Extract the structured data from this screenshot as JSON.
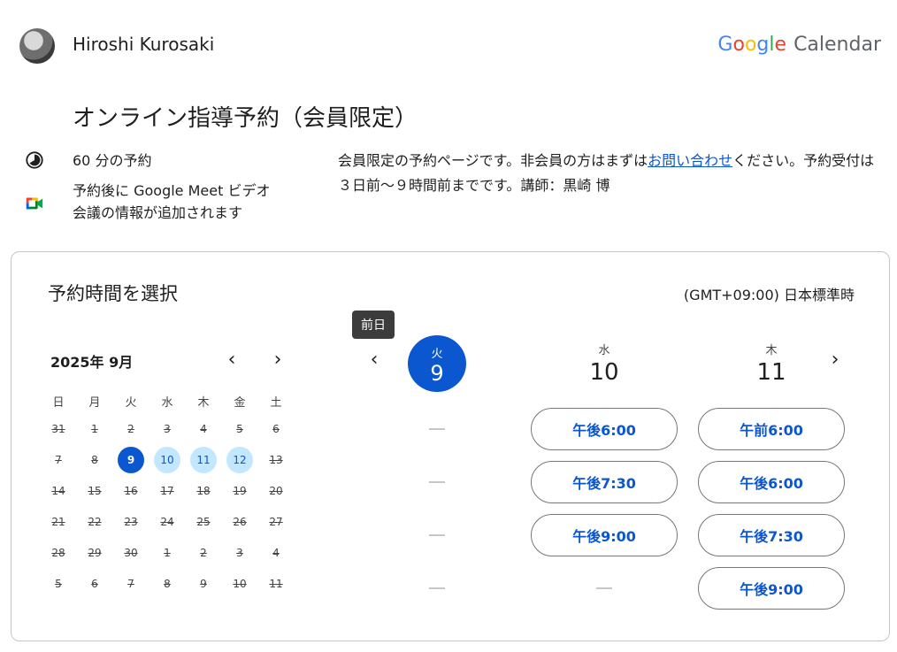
{
  "header": {
    "user_name": "Hiroshi Kurosaki",
    "brand_google": "Google",
    "brand_product": "Calendar"
  },
  "title": "オンライン指導予約（会員限定）",
  "info": {
    "duration": "60 分の予約",
    "meet_line1": "予約後に Google Meet ビデオ",
    "meet_line2": "会議の情報が追加されます"
  },
  "description": {
    "before_link": "会員限定の予約ページです。非会員の方はまずは",
    "link": "お問い合わせ",
    "after_link": "ください。予約受付は３日前〜９時間前までです。講師：黒崎 博"
  },
  "card": {
    "title": "予約時間を選択",
    "timezone": "(GMT+09:00) 日本標準時"
  },
  "mini_calendar": {
    "month_label": "2025年 9月",
    "weekdays": [
      "日",
      "月",
      "火",
      "水",
      "木",
      "金",
      "土"
    ],
    "weeks": [
      [
        {
          "d": "31",
          "s": "past"
        },
        {
          "d": "1",
          "s": "past"
        },
        {
          "d": "2",
          "s": "past"
        },
        {
          "d": "3",
          "s": "past"
        },
        {
          "d": "4",
          "s": "past"
        },
        {
          "d": "5",
          "s": "past"
        },
        {
          "d": "6",
          "s": "past"
        }
      ],
      [
        {
          "d": "7",
          "s": "past"
        },
        {
          "d": "8",
          "s": "past"
        },
        {
          "d": "9",
          "s": "sel"
        },
        {
          "d": "10",
          "s": "avail"
        },
        {
          "d": "11",
          "s": "avail"
        },
        {
          "d": "12",
          "s": "avail"
        },
        {
          "d": "13",
          "s": "past"
        }
      ],
      [
        {
          "d": "14",
          "s": "past"
        },
        {
          "d": "15",
          "s": "past"
        },
        {
          "d": "16",
          "s": "past"
        },
        {
          "d": "17",
          "s": "past"
        },
        {
          "d": "18",
          "s": "past"
        },
        {
          "d": "19",
          "s": "past"
        },
        {
          "d": "20",
          "s": "past"
        }
      ],
      [
        {
          "d": "21",
          "s": "past"
        },
        {
          "d": "22",
          "s": "past"
        },
        {
          "d": "23",
          "s": "past"
        },
        {
          "d": "24",
          "s": "past"
        },
        {
          "d": "25",
          "s": "past"
        },
        {
          "d": "26",
          "s": "past"
        },
        {
          "d": "27",
          "s": "past"
        }
      ],
      [
        {
          "d": "28",
          "s": "past"
        },
        {
          "d": "29",
          "s": "past"
        },
        {
          "d": "30",
          "s": "past"
        },
        {
          "d": "1",
          "s": "past"
        },
        {
          "d": "2",
          "s": "past"
        },
        {
          "d": "3",
          "s": "past"
        },
        {
          "d": "4",
          "s": "past"
        }
      ],
      [
        {
          "d": "5",
          "s": "past"
        },
        {
          "d": "6",
          "s": "past"
        },
        {
          "d": "7",
          "s": "past"
        },
        {
          "d": "8",
          "s": "past"
        },
        {
          "d": "9",
          "s": "past"
        },
        {
          "d": "10",
          "s": "past"
        },
        {
          "d": "11",
          "s": "past"
        }
      ]
    ]
  },
  "tooltip": "前日",
  "day_columns": [
    {
      "weekday": "火",
      "day": "9",
      "slots": []
    },
    {
      "weekday": "水",
      "day": "10",
      "slots": [
        "午後6:00",
        "午後7:30",
        "午後9:00"
      ]
    },
    {
      "weekday": "木",
      "day": "11",
      "slots": [
        "午前6:00",
        "午後6:00",
        "午後7:30",
        "午後9:00"
      ]
    }
  ],
  "colors": {
    "accent": "#0b57d0",
    "available_day_bg": "#c2e7ff"
  }
}
